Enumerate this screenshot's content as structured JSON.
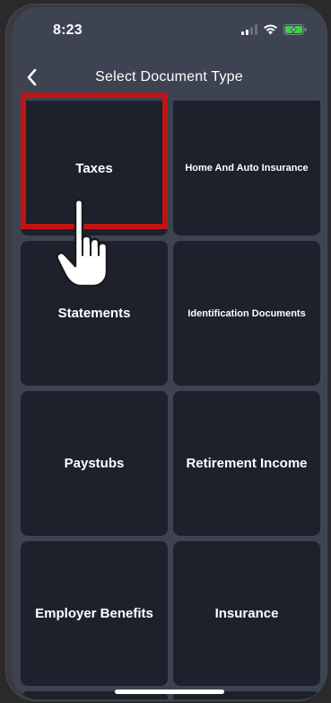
{
  "status_bar": {
    "time": "8:23"
  },
  "header": {
    "title": "Select Document Type",
    "back_icon": "chevron-left-icon"
  },
  "document_types": [
    "Taxes",
    "Home And Auto Insurance",
    "Statements",
    "Identification Documents",
    "Paystubs",
    "Retirement Income",
    "Employer Benefits",
    "Insurance"
  ],
  "colors": {
    "background": "#3d4350",
    "tile": "#1e202c",
    "highlight": "#c01414",
    "text": "#ffffff"
  },
  "annotations": {
    "highlighted_item": "Taxes",
    "pointer_icon": "hand-pointer-icon"
  }
}
